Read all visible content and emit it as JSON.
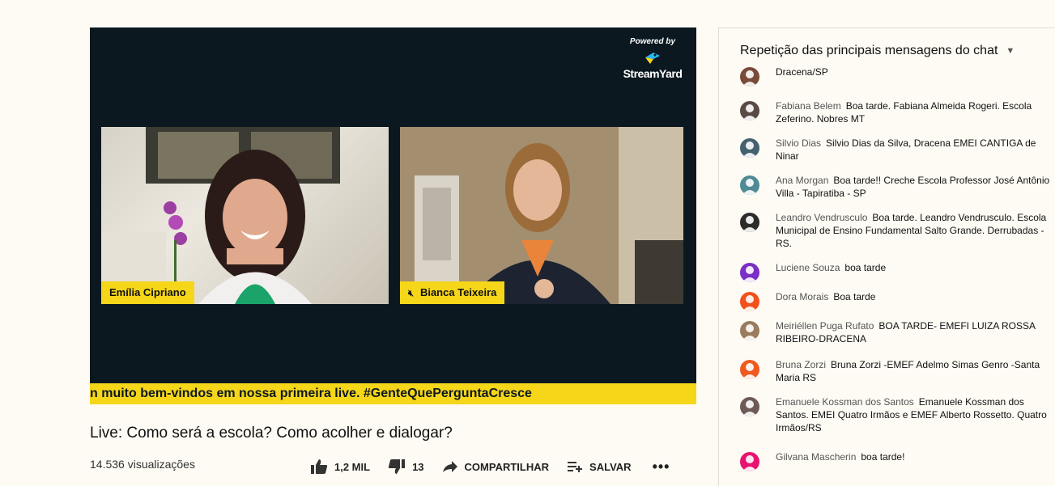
{
  "player": {
    "powered_by": "Powered by",
    "streamyard": "StreamYard",
    "host_left": "Emília Cipriano",
    "host_right": "Bianca Teixeira",
    "ticker": "n muito bem-vindos em nossa primeira live. #GenteQuePerguntaCresce"
  },
  "video": {
    "title": "Live: Como será a escola? Como acolher e dialogar?",
    "views": "14.536 visualizações",
    "like_count": "1,2 MIL",
    "dislike_count": "13",
    "share_label": "COMPARTILHAR",
    "save_label": "SALVAR",
    "more": "•••"
  },
  "chat": {
    "header": "Repetição das principais mensagens do chat",
    "messages": [
      {
        "author": "",
        "text": "Dracena/SP",
        "avatar_color": "#7a4a3a"
      },
      {
        "author": "Fabiana Belem",
        "text": "Boa tarde. Fabiana Almeida Rogeri. Escola Zeferino. Nobres MT",
        "avatar_color": "#5a4a46"
      },
      {
        "author": "Silvio Dias",
        "text": "Silvio Dias da Silva, Dracena EMEI CANTIGA de Ninar",
        "avatar_color": "#44616f"
      },
      {
        "author": "Ana Morgan",
        "text": "Boa tarde!! Creche Escola Professor José Antônio Villa - Tapiratiba - SP",
        "avatar_color": "#4f8b95"
      },
      {
        "author": "Leandro Vendrusculo",
        "text": "Boa tarde. Leandro Vendrusculo. Escola Municipal de Ensino Fundamental Salto Grande. Derrubadas - RS.",
        "avatar_color": "#2b2b2b"
      },
      {
        "author": "Luciene Souza",
        "text": "boa tarde",
        "avatar_color": "#7b2fc4"
      },
      {
        "author": "Dora Morais",
        "text": "Boa tarde",
        "avatar_color": "#f2511b"
      },
      {
        "author": "Meiriéllen Puga Rufato",
        "text": "BOA TARDE- EMEFI LUIZA ROSSA RIBEIRO-DRACENA",
        "avatar_color": "#9a7b5e"
      },
      {
        "author": "Bruna Zorzi",
        "text": "Bruna Zorzi -EMEF Adelmo Simas Genro -Santa Maria RS",
        "avatar_color": "#ee5a1f"
      },
      {
        "author": "Emanuele Kossman dos Santos",
        "text": "Emanuele Kossman dos Santos. EMEI Quatro Irmãos e EMEF Alberto Rossetto. Quatro Irmãos/RS",
        "avatar_color": "#6e5a56"
      },
      {
        "author": "Gilvana Mascherin",
        "text": "boa tarde!",
        "avatar_color": "#e8136f"
      }
    ]
  }
}
